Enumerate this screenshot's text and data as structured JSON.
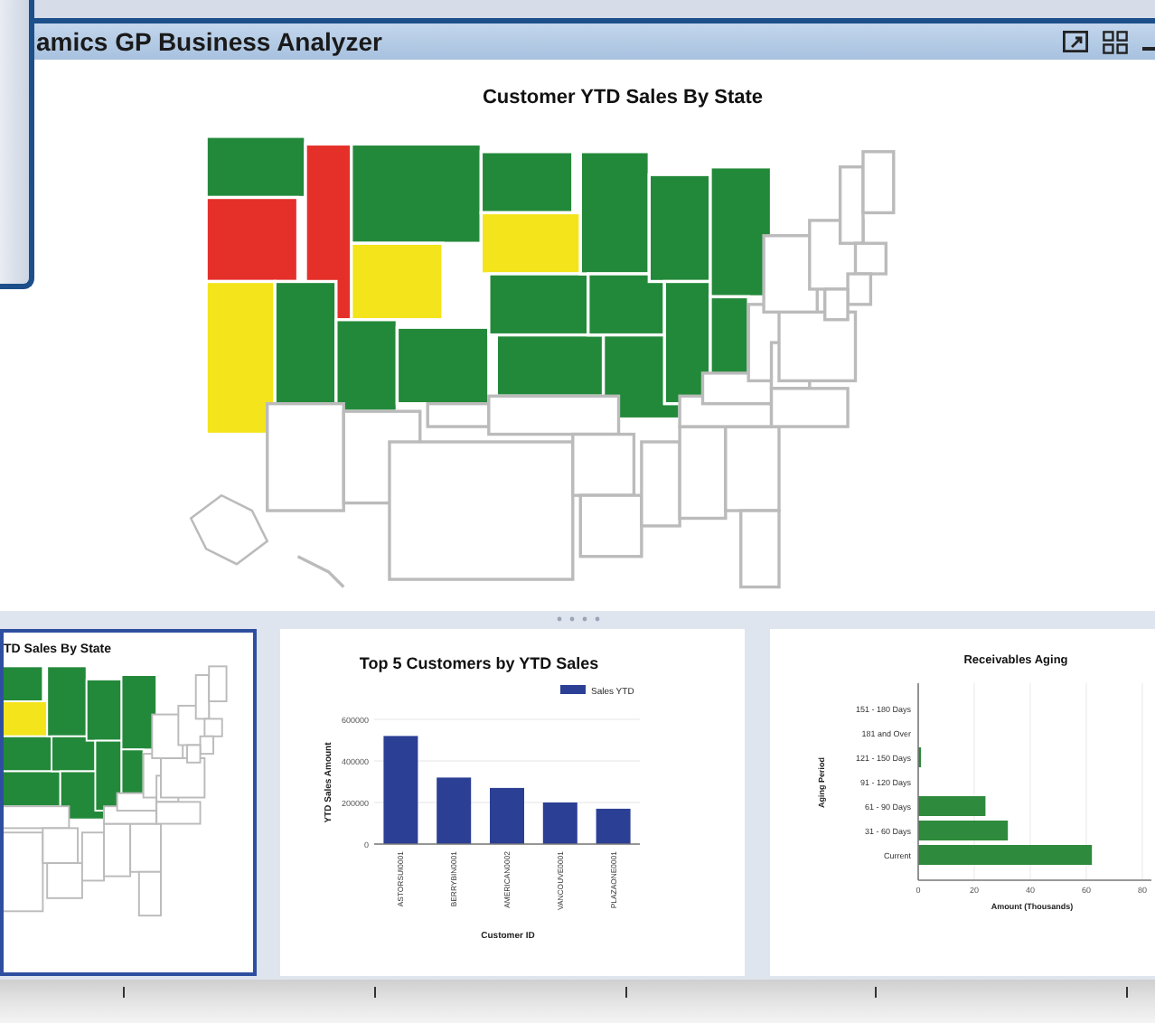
{
  "window": {
    "title": "amics GP Business Analyzer"
  },
  "main_panel": {
    "title": "Customer YTD Sales By State"
  },
  "cards": [
    {
      "kind": "map",
      "title": "TD Sales By State",
      "selected": true
    },
    {
      "kind": "chart",
      "title": "Top 5 Customers by YTD Sales",
      "selected": false,
      "chart_data": {
        "type": "bar",
        "xlabel": "Customer ID",
        "ylabel": "YTD Sales Amount",
        "categories": [
          "ASTORSUI0001",
          "BERRYBIN0001",
          "AMERICAN0002",
          "VANCOUVE0001",
          "PLAZAONE0001"
        ],
        "series": [
          {
            "name": "Sales YTD",
            "color": "#2b3f94",
            "values": [
              520000,
              320000,
              270000,
              200000,
              170000
            ]
          }
        ],
        "ylim": [
          0,
          600000
        ],
        "yticks": [
          0,
          200000,
          400000,
          600000
        ],
        "grid": true
      }
    },
    {
      "kind": "chart",
      "title": "Receivables Aging",
      "selected": false,
      "chart_data": {
        "type": "bar",
        "orientation": "horizontal",
        "xlabel": "Amount (Thousands)",
        "ylabel": "Aging Period",
        "categories": [
          "151 - 180 Days",
          "181 and Over",
          "121 - 150 Days",
          "91 - 120 Days",
          "61 - 90 Days",
          "31 - 60 Days",
          "Current"
        ],
        "series": [
          {
            "color": "#2e8a3c",
            "values": [
              0,
              0,
              1,
              0,
              24,
              32,
              62
            ]
          }
        ],
        "xlim": [
          0,
          80
        ],
        "xticks": [
          0,
          20,
          40,
          60,
          80
        ],
        "grid": true
      }
    }
  ]
}
